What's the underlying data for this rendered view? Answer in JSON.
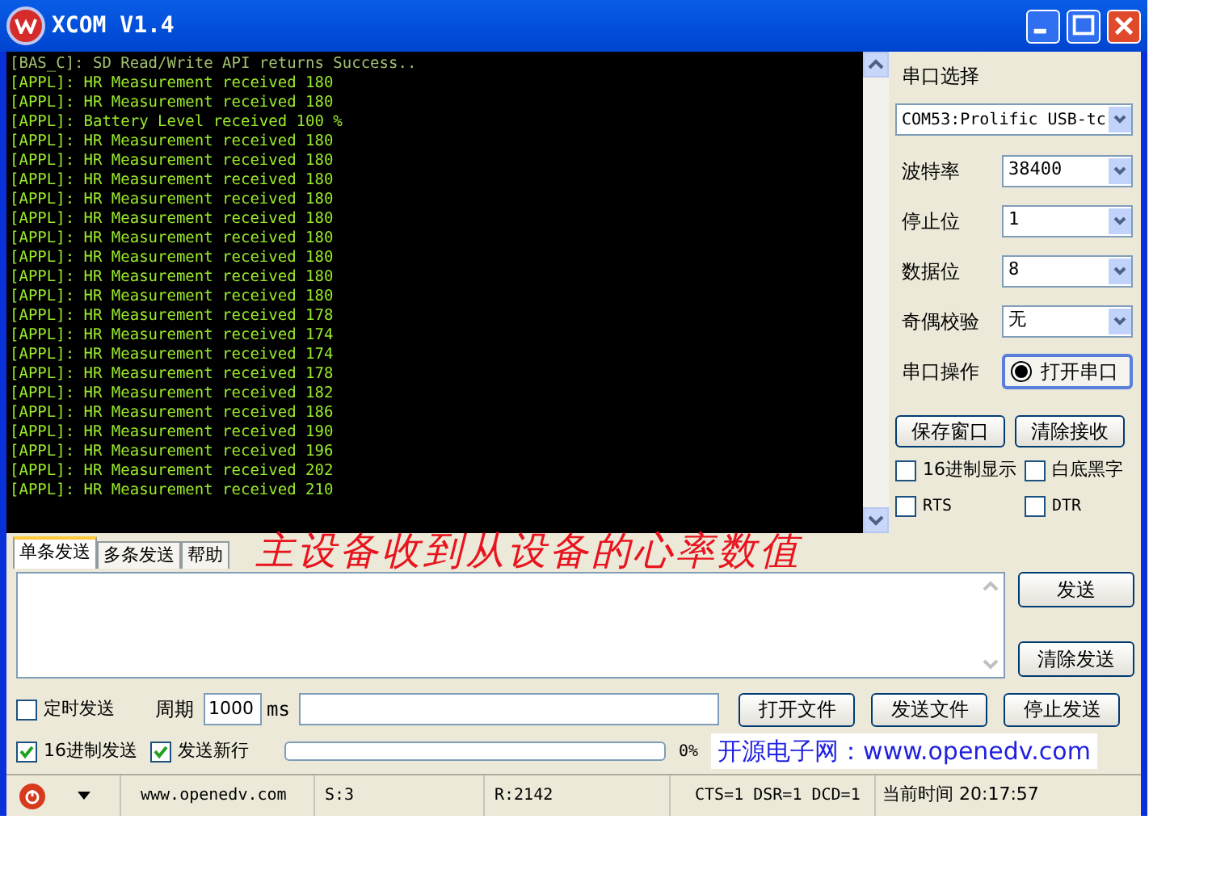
{
  "window": {
    "title": "XCOM V1.4"
  },
  "log": [
    "[BAS_C]: SD Read/Write API returns Success..",
    "[APPL]: HR Measurement received 180",
    "[APPL]: HR Measurement received 180",
    "[APPL]: Battery Level received 100 %",
    "[APPL]: HR Measurement received 180",
    "[APPL]: HR Measurement received 180",
    "[APPL]: HR Measurement received 180",
    "[APPL]: HR Measurement received 180",
    "[APPL]: HR Measurement received 180",
    "[APPL]: HR Measurement received 180",
    "[APPL]: HR Measurement received 180",
    "[APPL]: HR Measurement received 180",
    "[APPL]: HR Measurement received 180",
    "[APPL]: HR Measurement received 178",
    "[APPL]: HR Measurement received 174",
    "[APPL]: HR Measurement received 174",
    "[APPL]: HR Measurement received 178",
    "[APPL]: HR Measurement received 182",
    "[APPL]: HR Measurement received 186",
    "[APPL]: HR Measurement received 190",
    "[APPL]: HR Measurement received 196",
    "[APPL]: HR Measurement received 202",
    "[APPL]: HR Measurement received 210"
  ],
  "port_panel": {
    "title": "串口选择",
    "port": "COM53:Prolific USB-tc",
    "settings": [
      {
        "label": "波特率",
        "value": "38400"
      },
      {
        "label": "停止位",
        "value": "1"
      },
      {
        "label": "数据位",
        "value": "8"
      },
      {
        "label": "奇偶校验",
        "value": "无"
      }
    ],
    "operation_label": "串口操作",
    "open_button": "打开串口",
    "buttons": [
      "保存窗口",
      "清除接收"
    ],
    "options": [
      {
        "label": "16进制显示",
        "checked": false
      },
      {
        "label": "白底黑字",
        "checked": false
      },
      {
        "label": "RTS",
        "checked": false
      },
      {
        "label": "DTR",
        "checked": false
      }
    ]
  },
  "tabs": [
    {
      "label": "单条发送",
      "selected": true
    },
    {
      "label": "多条发送",
      "selected": false
    },
    {
      "label": "帮助",
      "selected": false
    }
  ],
  "annotation": "主设备收到从设备的心率数值",
  "send_buttons": [
    "发送",
    "清除发送"
  ],
  "timed_send": {
    "label": "定时发送",
    "checked": false
  },
  "period_label": "周期",
  "period": "1000",
  "period_unit": "ms",
  "file_buttons": [
    "打开文件",
    "发送文件",
    "停止发送"
  ],
  "send_options": [
    {
      "label": "16进制发送",
      "checked": true
    },
    {
      "label": "发送新行",
      "checked": true
    }
  ],
  "progress": {
    "level": 0,
    "reading": "0%"
  },
  "website_banner": "开源电子网：www.openedv.com",
  "status_bar": [
    "www.openedv.com",
    "S:3",
    "R:2142",
    "CTS=1 DSR=1 DCD=1",
    "当前时间 20:17:57"
  ]
}
